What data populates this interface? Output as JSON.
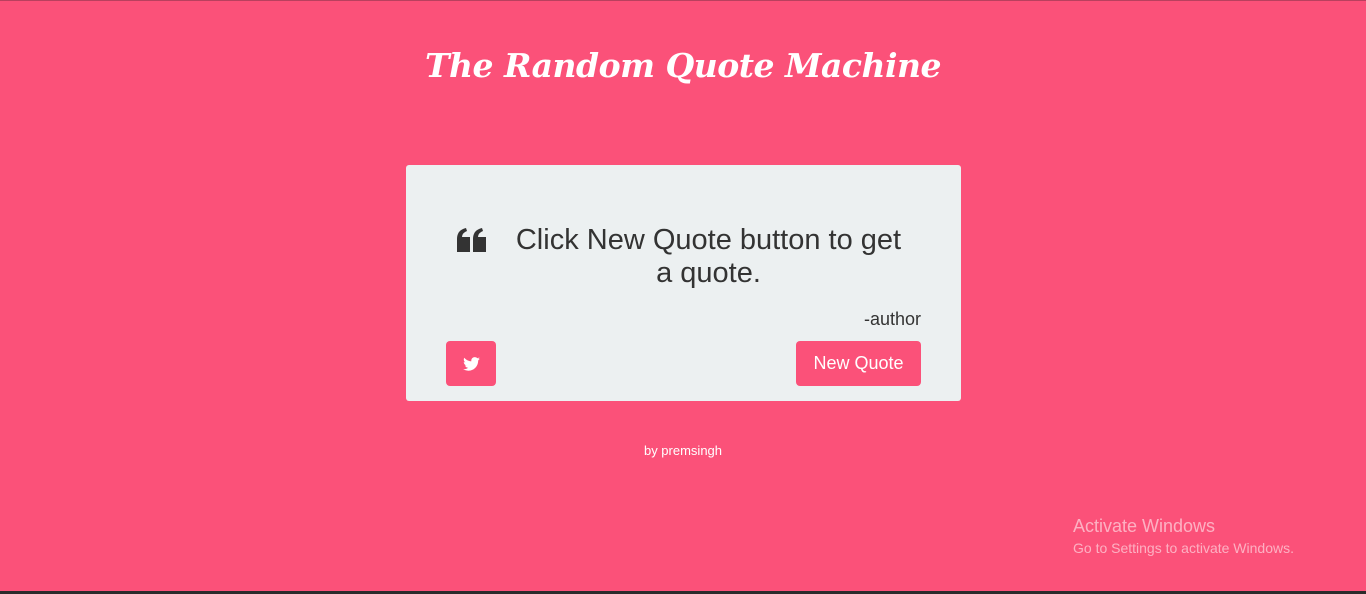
{
  "header": {
    "title": "The Random Quote Machine"
  },
  "quote_box": {
    "text": "Click New Quote button to get a quote.",
    "author": "-author",
    "new_quote_label": "New Quote",
    "tweet_icon": "twitter-icon",
    "quote_icon": "quote-left-icon"
  },
  "footer": {
    "credit": "by premsingh"
  },
  "watermark": {
    "title": "Activate Windows",
    "subtitle": "Go to Settings to activate Windows."
  },
  "colors": {
    "background": "#fb5179",
    "card": "#ecf0f1",
    "text": "#333333",
    "button": "#fb5179"
  }
}
